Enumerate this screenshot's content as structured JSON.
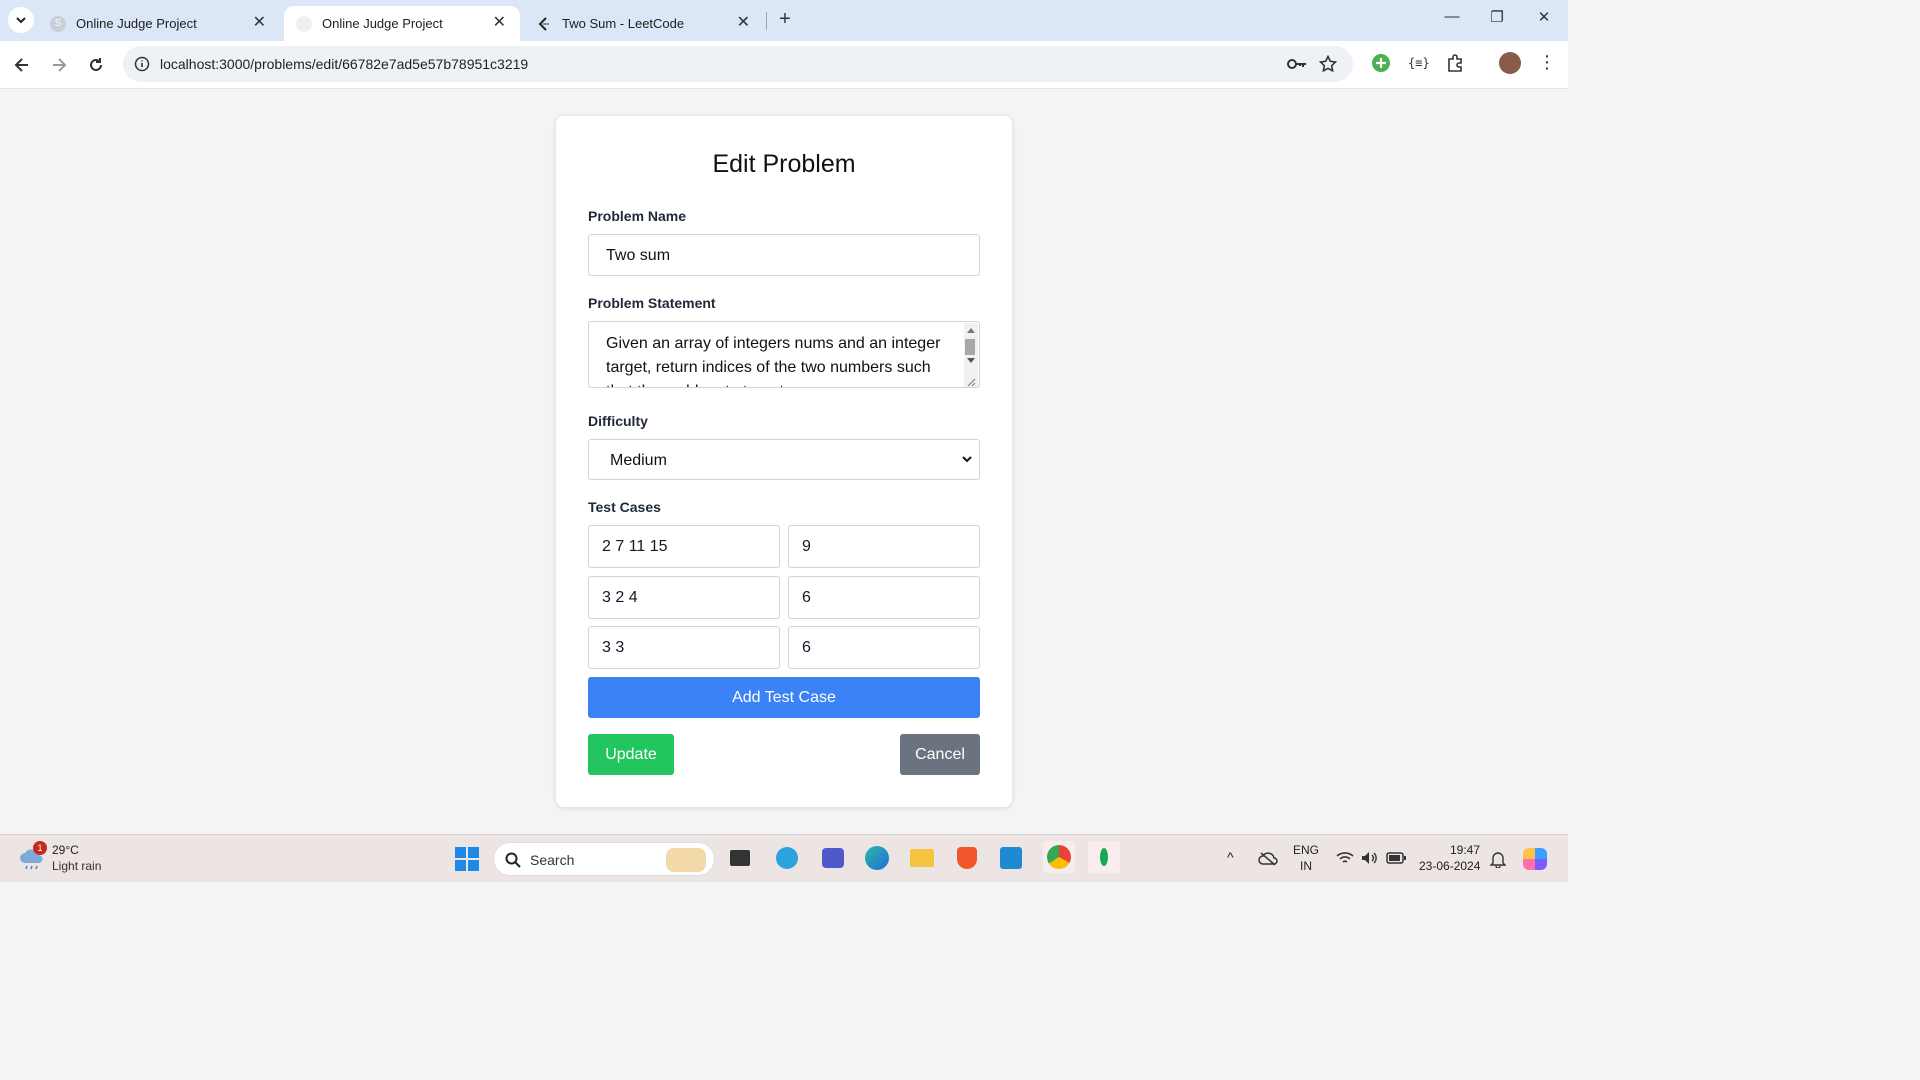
{
  "browser": {
    "tabs": [
      {
        "title": "Online Judge Project",
        "active": false
      },
      {
        "title": "Online Judge Project",
        "active": true
      },
      {
        "title": "Two Sum - LeetCode",
        "active": false
      }
    ],
    "url": "localhost:3000/problems/edit/66782e7ad5e57b78951c3219"
  },
  "form": {
    "title": "Edit Problem",
    "name_label": "Problem Name",
    "name_value": "Two sum",
    "statement_label": "Problem Statement",
    "statement_value": "Given an array of integers nums and an integer target, return indices of the two numbers such that they add up to target.",
    "difficulty_label": "Difficulty",
    "difficulty_value": "Medium",
    "testcases_label": "Test Cases",
    "testcases": [
      {
        "input": "2 7 11 15",
        "output": "9"
      },
      {
        "input": "3 2 4",
        "output": "6"
      },
      {
        "input": "3 3",
        "output": "6"
      }
    ],
    "add_testcase_label": "Add Test Case",
    "update_label": "Update",
    "cancel_label": "Cancel"
  },
  "taskbar": {
    "weather_temp": "29°C",
    "weather_desc": "Light rain",
    "weather_badge": "1",
    "search_label": "Search",
    "lang_1": "ENG",
    "lang_2": "IN",
    "time": "19:47",
    "date": "23-06-2024"
  },
  "colors": {
    "add_button": "#3b82f6",
    "update_button": "#22c55e",
    "cancel_button": "#6b7280"
  }
}
